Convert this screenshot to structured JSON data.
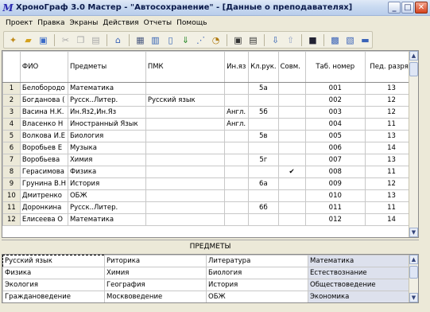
{
  "window": {
    "title": "ХроноГраф 3.0 Мастер - \"Автосохранение\" - [Данные о преподавателях]",
    "app_icon": "М"
  },
  "menu": [
    "Проект",
    "Правка",
    "Экраны",
    "Действия",
    "Отчеты",
    "Помощь"
  ],
  "grid": {
    "headers": [
      "ФИО",
      "Предметы",
      "ПМК",
      "Ин.яз",
      "Кл.рук.",
      "Совм.",
      "Таб. номер",
      "Пед. разряд"
    ],
    "rows": [
      {
        "n": "1",
        "fio": "Белобородо",
        "subj": "Математика",
        "pmk": "",
        "lang": "",
        "cls": "5а",
        "comb": "",
        "tab": "001",
        "rank": "13"
      },
      {
        "n": "2",
        "fio": "Богданова (",
        "subj": "Русск..Литер.",
        "pmk": "Русский язык",
        "lang": "",
        "cls": "",
        "comb": "",
        "tab": "002",
        "rank": "12"
      },
      {
        "n": "3",
        "fio": "Васина Н.К.",
        "subj": "Ин.Яз2,Ин.Яз",
        "pmk": "",
        "lang": "Англ.",
        "cls": "5б",
        "comb": "",
        "tab": "003",
        "rank": "12"
      },
      {
        "n": "4",
        "fio": "Власенко Н",
        "subj": "Иностранный Язык",
        "pmk": "",
        "lang": "Англ.",
        "cls": "",
        "comb": "",
        "tab": "004",
        "rank": "11"
      },
      {
        "n": "5",
        "fio": "Волкова И.Е",
        "subj": "Биология",
        "pmk": "",
        "lang": "",
        "cls": "5в",
        "comb": "",
        "tab": "005",
        "rank": "13"
      },
      {
        "n": "6",
        "fio": "Воробьев Е",
        "subj": "Музыка",
        "pmk": "",
        "lang": "",
        "cls": "",
        "comb": "",
        "tab": "006",
        "rank": "14"
      },
      {
        "n": "7",
        "fio": "Воробьева ",
        "subj": "Химия",
        "pmk": "",
        "lang": "",
        "cls": "5г",
        "comb": "",
        "tab": "007",
        "rank": "13"
      },
      {
        "n": "8",
        "fio": "Герасимова",
        "subj": "Физика",
        "pmk": "",
        "lang": "",
        "cls": "",
        "comb": "✔",
        "tab": "008",
        "rank": "11"
      },
      {
        "n": "9",
        "fio": "Грунина В.Н",
        "subj": "История",
        "pmk": "",
        "lang": "",
        "cls": "6а",
        "comb": "",
        "tab": "009",
        "rank": "12"
      },
      {
        "n": "10",
        "fio": "Дмитренко",
        "subj": "ОБЖ",
        "pmk": "",
        "lang": "",
        "cls": "",
        "comb": "",
        "tab": "010",
        "rank": "13"
      },
      {
        "n": "11",
        "fio": "Доронкина ",
        "subj": "Русск..Литер.",
        "pmk": "",
        "lang": "",
        "cls": "6б",
        "comb": "",
        "tab": "011",
        "rank": "11"
      },
      {
        "n": "12",
        "fio": "Елисеева О",
        "subj": "Математика",
        "pmk": "",
        "lang": "",
        "cls": "",
        "comb": "",
        "tab": "012",
        "rank": "14"
      }
    ]
  },
  "subjects": {
    "title": "ПРЕДМЕТЫ",
    "rows": [
      [
        "Русский язык",
        "Риторика",
        "Литература",
        "Математика"
      ],
      [
        "Физика",
        "Химия",
        "Биология",
        "Естествознание"
      ],
      [
        "Экология",
        "География",
        "История",
        "Обществоведение"
      ],
      [
        "Граждановедение",
        "Москвоведение",
        "ОБЖ",
        "Экономика"
      ]
    ]
  },
  "toolbar_icons": [
    "new-icon",
    "open-icon",
    "save-icon",
    "cut-icon",
    "copy-icon",
    "paste-icon",
    "home-icon",
    "table-icon",
    "folder-icon",
    "page-icon",
    "arrow-icon",
    "chart-icon",
    "clock-icon",
    "window-icon",
    "window2-icon",
    "down-icon",
    "up-icon",
    "black-icon",
    "flag1-icon",
    "flag2-icon",
    "flag3-icon"
  ]
}
